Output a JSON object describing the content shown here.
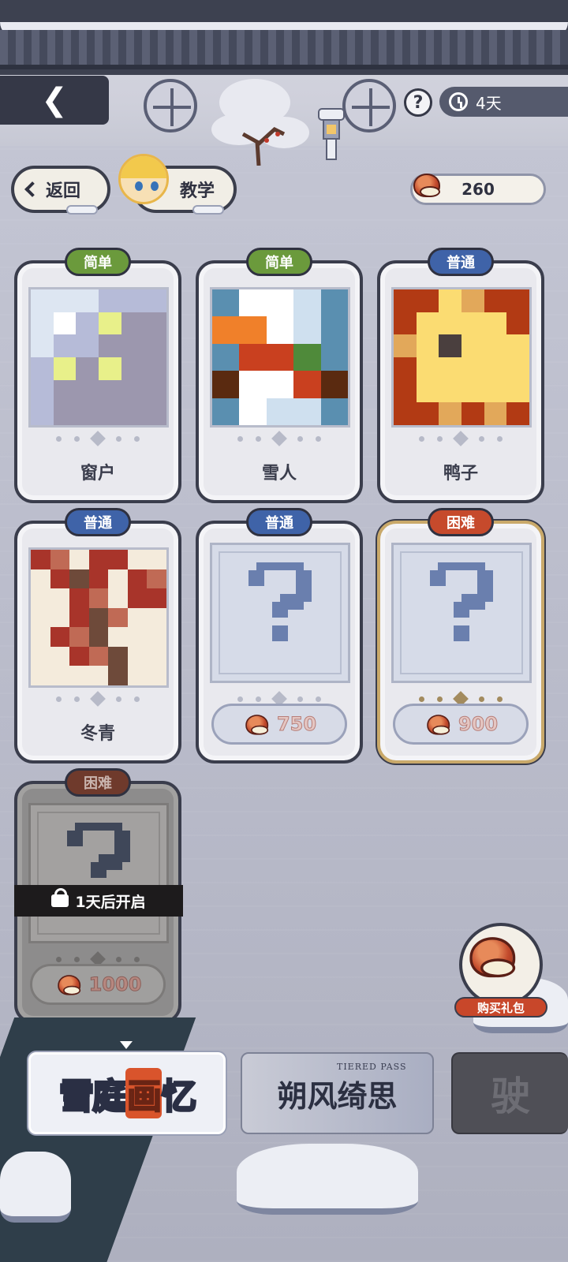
{
  "topbar": {
    "timer_label": "4天",
    "help_label": "?"
  },
  "nav": {
    "return_label": "返回",
    "teach_label": "教学"
  },
  "currency": {
    "amount": "260"
  },
  "cards": [
    {
      "difficulty": "简单",
      "name": "窗户",
      "state": "unlocked"
    },
    {
      "difficulty": "简单",
      "name": "雪人",
      "state": "unlocked"
    },
    {
      "difficulty": "普通",
      "name": "鸭子",
      "state": "unlocked"
    },
    {
      "difficulty": "普通",
      "name": "冬青",
      "state": "unlocked"
    },
    {
      "difficulty": "普通",
      "price": "750",
      "state": "purchasable"
    },
    {
      "difficulty": "困难",
      "price": "900",
      "state": "purchasable"
    },
    {
      "difficulty": "困难",
      "price": "1000",
      "state": "locked",
      "lock_text": "1天后开启"
    }
  ],
  "gift": {
    "label": "购买礼包"
  },
  "tabs": [
    {
      "title_a": "雪庭",
      "title_stamp": "画",
      "title_b": "忆",
      "active": true
    },
    {
      "title": "朔风绮思",
      "subtitle": "TIERED PASS",
      "active": false
    },
    {
      "glyph": "驶",
      "active": false
    }
  ],
  "colors": {
    "easy": "#6b9a3c",
    "normal": "#3f63a8",
    "hard": "#c64a2c",
    "accent_red": "#c8472a"
  }
}
